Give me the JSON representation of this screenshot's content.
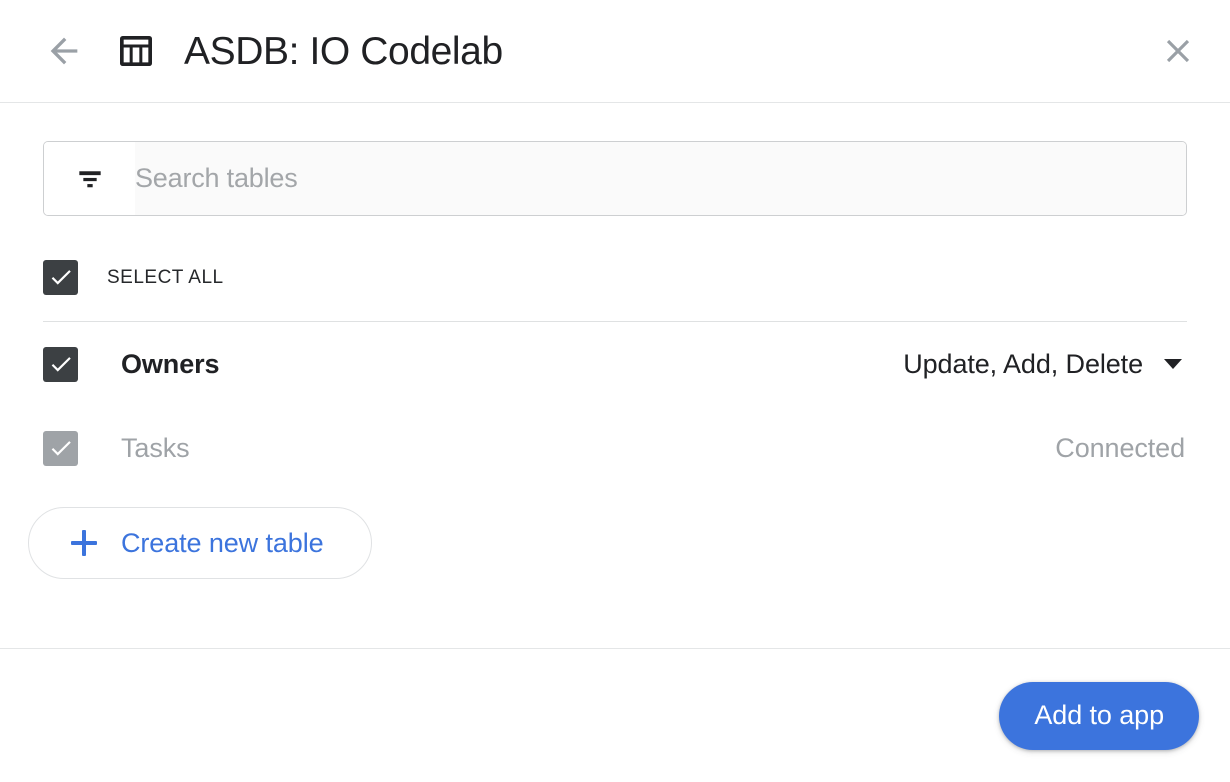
{
  "header": {
    "back_icon": "arrow-left-icon",
    "app_icon": "table-icon",
    "title": "ASDB: IO Codelab",
    "close_icon": "close-icon"
  },
  "search": {
    "icon": "filter-list-icon",
    "placeholder": "Search tables",
    "value": ""
  },
  "select_all": {
    "label": "SELECT ALL",
    "checked": true
  },
  "tables": [
    {
      "name": "Owners",
      "checked": true,
      "enabled": true,
      "right_type": "dropdown",
      "right_label": "Update, Add, Delete",
      "caret_icon": "chevron-down-icon"
    },
    {
      "name": "Tasks",
      "checked": true,
      "enabled": false,
      "right_type": "status",
      "right_label": "Connected"
    }
  ],
  "create_table": {
    "icon": "plus-icon",
    "label": "Create new table"
  },
  "footer": {
    "primary_label": "Add to app"
  },
  "colors": {
    "accent_blue": "#3c74dd",
    "checkbox_checked": "#3c4043",
    "checkbox_disabled": "#9fa3a7",
    "text_primary": "#202124",
    "text_muted": "#9fa3a7",
    "divider": "#e4e6e7"
  }
}
